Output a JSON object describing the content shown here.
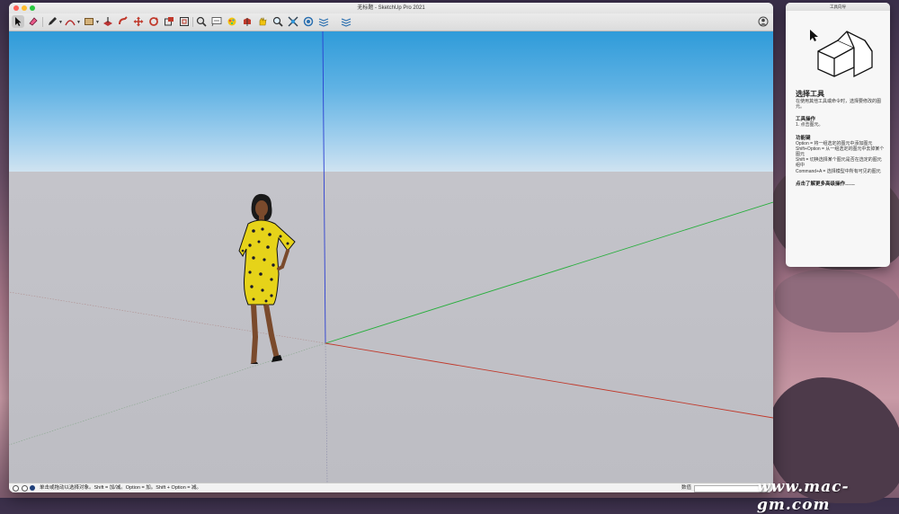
{
  "window": {
    "title": "无标题 - SketchUp Pro 2021"
  },
  "toolbar": {
    "tools": [
      {
        "name": "select-tool",
        "icon": "arrow-cursor-icon"
      },
      {
        "name": "eraser-tool",
        "icon": "eraser-icon"
      },
      {
        "name": "pencil-tool",
        "icon": "pencil-icon"
      },
      {
        "name": "arc-tool",
        "icon": "arc-icon"
      },
      {
        "name": "shape-tool",
        "icon": "rectangle-icon"
      },
      {
        "name": "push-pull-tool",
        "icon": "push-pull-icon"
      },
      {
        "name": "follow-me-tool",
        "icon": "follow-me-icon"
      },
      {
        "name": "move-tool",
        "icon": "move-icon"
      },
      {
        "name": "rotate-tool",
        "icon": "rotate-icon"
      },
      {
        "name": "scale-tool",
        "icon": "scale-icon"
      },
      {
        "name": "offset-tool",
        "icon": "offset-icon"
      },
      {
        "name": "tape-measure-tool",
        "icon": "tape-measure-icon"
      },
      {
        "name": "text-tool",
        "icon": "text-icon"
      },
      {
        "name": "paint-bucket-tool",
        "icon": "paint-bucket-icon"
      },
      {
        "name": "orbit-tool",
        "icon": "orbit-icon"
      },
      {
        "name": "pan-tool",
        "icon": "pan-icon"
      },
      {
        "name": "zoom-tool",
        "icon": "zoom-icon"
      },
      {
        "name": "zoom-extents-tool",
        "icon": "zoom-extents-icon"
      },
      {
        "name": "warehouse-tool",
        "icon": "warehouse-icon"
      },
      {
        "name": "extension-warehouse-tool",
        "icon": "extension-warehouse-icon"
      },
      {
        "name": "send-to-layout-tool",
        "icon": "layout-icon"
      }
    ]
  },
  "status": {
    "hint": "单击或拖动以选择对象。Shift = 加/减。Option = 加。Shift + Option = 减。",
    "measure_label": "数值"
  },
  "instructor": {
    "window_title": "工具向导",
    "heading": "选择工具",
    "desc": "在使用其他工具或命令时，选择要修改的图元。",
    "ops_title": "工具操作",
    "ops": "1. 点击图元。",
    "keys_title": "功能键",
    "keys": [
      "Option = 将一组选定的图元中添加图元",
      "Shift+Option = 从一组选定的图元中去掉某个图元",
      "Shift = 切换选择某个图元是否在选定的图元组中",
      "Command+A = 选择模型中所有可见的图元"
    ],
    "more_link": "点击了解更多高级操作……"
  },
  "watermark": {
    "text": "www.mac-gm.com"
  },
  "colors": {
    "sky_top": "#2f9bd9",
    "ground": "#c4c4ca",
    "axis_red": "#c0392b",
    "axis_green": "#27ae3c",
    "axis_blue": "#2b3fd1"
  }
}
